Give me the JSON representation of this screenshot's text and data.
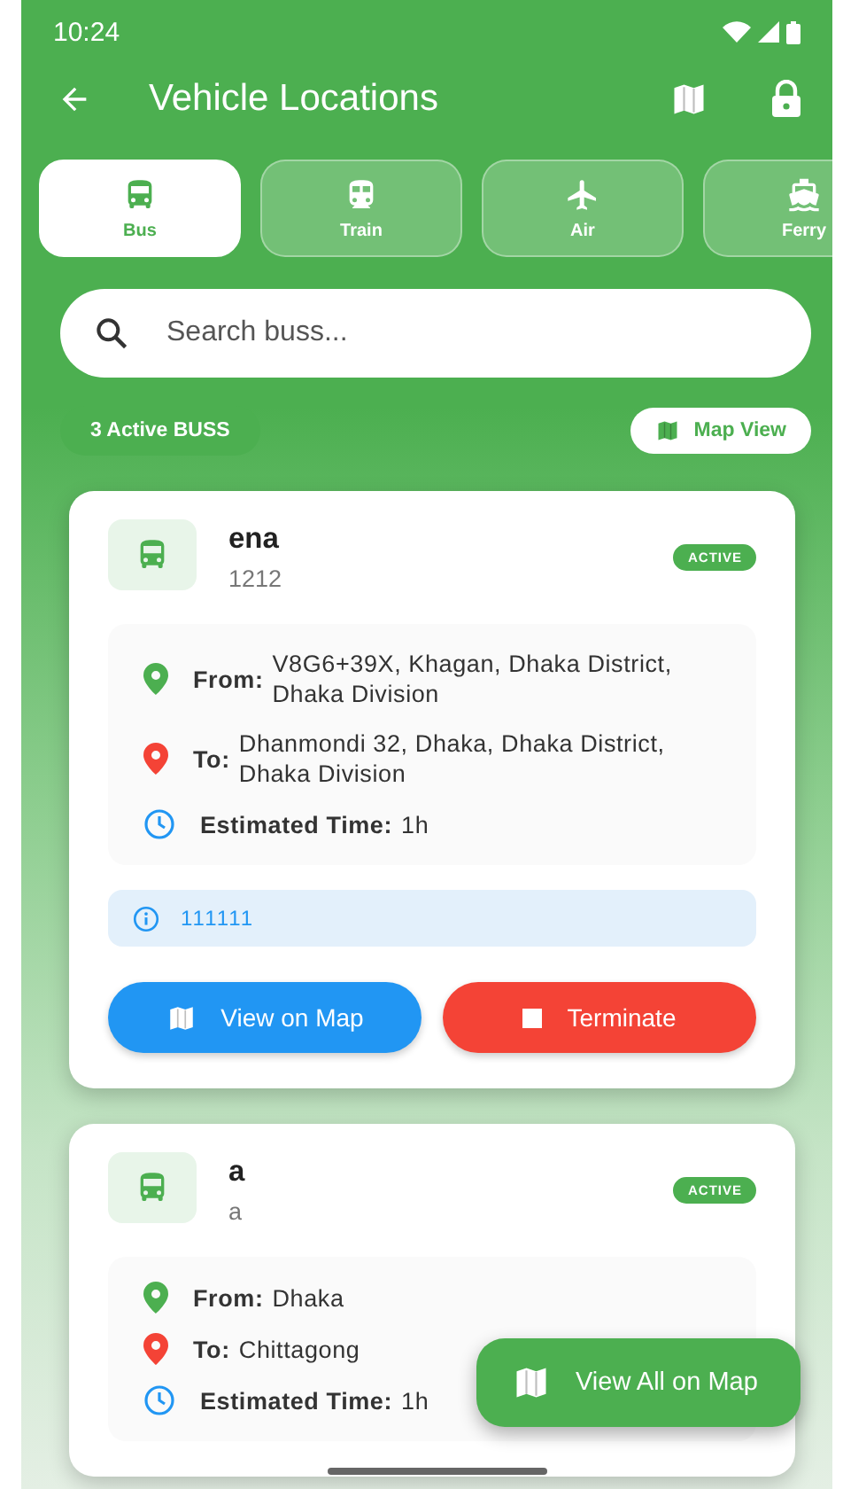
{
  "status_bar": {
    "time": "10:24"
  },
  "app_bar": {
    "title": "Vehicle Locations"
  },
  "tabs": [
    {
      "kind": "bus",
      "label": "Bus",
      "selected": true
    },
    {
      "kind": "train",
      "label": "Train",
      "selected": false
    },
    {
      "kind": "air",
      "label": "Air",
      "selected": false
    },
    {
      "kind": "ferry",
      "label": "Ferry",
      "selected": false
    }
  ],
  "search": {
    "placeholder": "Search buss..."
  },
  "summary": {
    "count_badge": "3 Active BUSS",
    "map_view_button": "Map View"
  },
  "vehicles": [
    {
      "name": "ena",
      "number": "1212",
      "status": "ACTIVE",
      "details": [
        {
          "kind": "from",
          "label": "From:",
          "value": "V8G6+39X, Khagan, Dhaka District, Dhaka Division"
        },
        {
          "kind": "to",
          "label": "To:",
          "value": "Dhanmondi 32, Dhaka, Dhaka District, Dhaka Division"
        },
        {
          "kind": "eta",
          "label": "Estimated Time:",
          "value": "1h"
        }
      ],
      "note": "111111",
      "actions": [
        {
          "kind": "map",
          "label": "View on Map"
        },
        {
          "kind": "terminate",
          "label": "Terminate"
        }
      ]
    },
    {
      "name": "a",
      "number": "a",
      "status": "ACTIVE",
      "details": [
        {
          "kind": "from",
          "label": "From:",
          "value": "Dhaka"
        },
        {
          "kind": "to",
          "label": "To:",
          "value": "Chittagong"
        },
        {
          "kind": "eta",
          "label": "Estimated Time:",
          "value": "1h"
        }
      ]
    }
  ],
  "fab": {
    "label": "View All on Map"
  }
}
